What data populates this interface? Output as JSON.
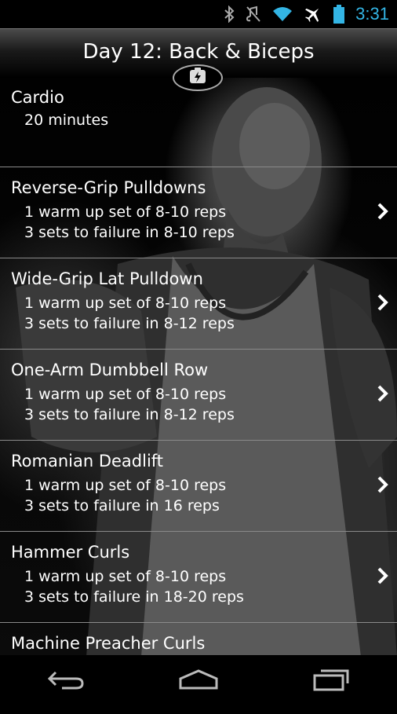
{
  "status_bar": {
    "time": "3:31",
    "icons": [
      "bluetooth-icon",
      "mute-icon",
      "wifi-icon",
      "airplane-icon",
      "battery-icon"
    ],
    "time_color": "#33b5e5"
  },
  "header": {
    "title": "Day 12: Back & Biceps",
    "badge_icon": "flash-icon"
  },
  "exercises": [
    {
      "name": "Cardio",
      "line1": "20 minutes",
      "line2": ""
    },
    {
      "name": "Reverse-Grip Pulldowns",
      "line1": "1 warm up set of 8-10 reps",
      "line2": "3 sets to failure in 8-10 reps"
    },
    {
      "name": "Wide-Grip Lat Pulldown",
      "line1": "1 warm up set of 8-10 reps",
      "line2": "3 sets to failure in 8-12 reps"
    },
    {
      "name": "One-Arm Dumbbell Row",
      "line1": "1 warm up set of 8-10 reps",
      "line2": "3 sets to failure in 8-12 reps"
    },
    {
      "name": "Romanian Deadlift",
      "line1": "1 warm up set of 8-10 reps",
      "line2": "3 sets to failure in 16 reps"
    },
    {
      "name": "Hammer Curls",
      "line1": "1 warm up set of 8-10 reps",
      "line2": "3 sets to failure in 18-20 reps"
    },
    {
      "name": "Machine Preacher Curls",
      "line1": "",
      "line2": ""
    }
  ],
  "nav": {
    "icons": [
      "back-icon",
      "home-icon",
      "recent-apps-icon"
    ]
  }
}
